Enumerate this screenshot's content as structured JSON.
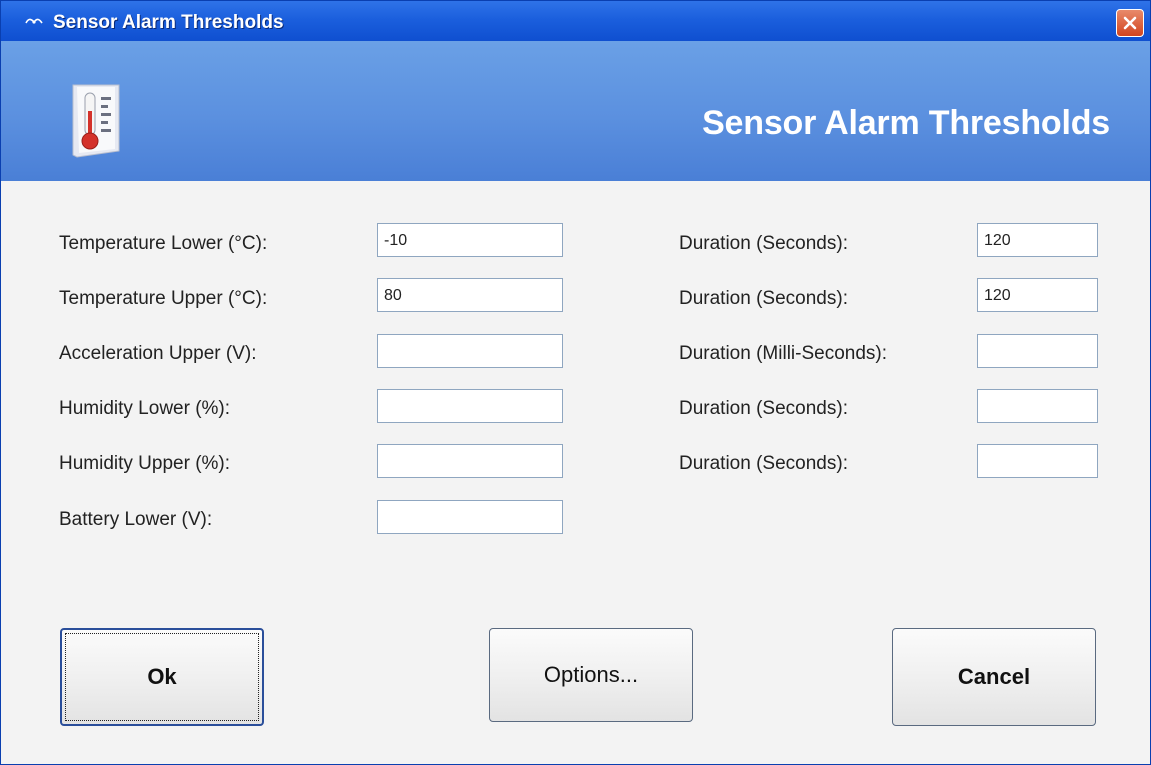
{
  "window": {
    "title": "Sensor Alarm Thresholds",
    "close_icon": "close-icon",
    "app_icon": "signal-icon"
  },
  "banner": {
    "title": "Sensor Alarm Thresholds",
    "icon": "thermometer-icon"
  },
  "thresholds": [
    {
      "label": "Temperature Lower (°C):",
      "value": "-10"
    },
    {
      "label": "Temperature Upper (°C):",
      "value": "80"
    },
    {
      "label": "Acceleration Upper (V):",
      "value": ""
    },
    {
      "label": "Humidity Lower (%):",
      "value": ""
    },
    {
      "label": "Humidity Upper (%):",
      "value": ""
    },
    {
      "label": "Battery Lower (V):",
      "value": ""
    }
  ],
  "durations": [
    {
      "label": "Duration (Seconds):",
      "value": "120"
    },
    {
      "label": "Duration (Seconds):",
      "value": "120"
    },
    {
      "label": "Duration (Milli-Seconds):",
      "value": ""
    },
    {
      "label": "Duration (Seconds):",
      "value": ""
    },
    {
      "label": "Duration (Seconds):",
      "value": ""
    }
  ],
  "buttons": {
    "ok": "Ok",
    "options": "Options...",
    "cancel": "Cancel"
  },
  "colors": {
    "titlebar": "#1b5fdd",
    "banner": "#5b90df",
    "close": "#d3451f"
  }
}
